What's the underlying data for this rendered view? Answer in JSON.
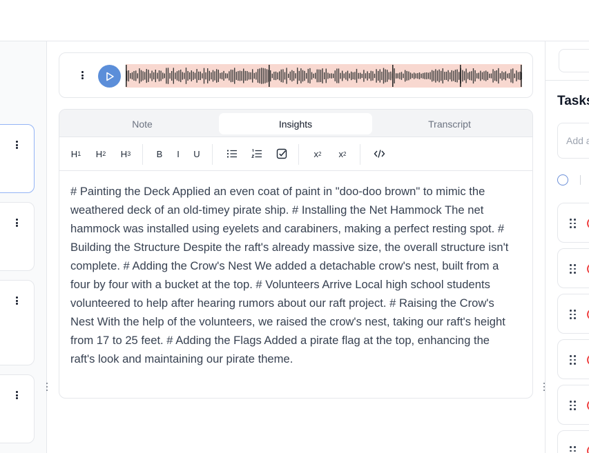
{
  "audio": {
    "menu_icon": "vertical-ellipsis-icon",
    "play_icon": "play-icon",
    "accent_color": "#5b8ed9",
    "waveform_bg": "#f8d8d0"
  },
  "tabs": [
    {
      "label": "Note",
      "active": false
    },
    {
      "label": "Insights",
      "active": true
    },
    {
      "label": "Transcript",
      "active": false
    }
  ],
  "toolbar": {
    "h1": {
      "main": "H",
      "sub": "1"
    },
    "h2": {
      "main": "H",
      "sub": "2"
    },
    "h3": {
      "main": "H",
      "sub": "3"
    },
    "bold": "B",
    "italic": "I",
    "underline": "U",
    "subscript": {
      "main": "x",
      "sub": "2"
    },
    "superscript": {
      "main": "x",
      "sup": "2"
    },
    "icons": [
      "bullet-list-icon",
      "numbered-list-icon",
      "checklist-icon",
      "code-icon"
    ]
  },
  "editor": {
    "content": "# Painting the Deck Applied an even coat of paint in \"doo-doo brown\" to mimic the weathered deck of an old-timey pirate ship. # Installing the Net Hammock The net hammock was installed using eyelets and carabiners, making a perfect resting spot. # Building the Structure Despite the raft's already massive size, the overall structure isn't complete. # Adding the Crow's Nest We added a detachable crow's nest, built from a four by four with a bucket at the top. # Volunteers Arrive Local high school students volunteered to help after hearing rumors about our raft project. # Raising the Crow's Nest With the help of the volunteers, we raised the crow's nest, taking our raft's height from 17 to 25 feet. # Adding the Flags Added a pirate flag at the top, enhancing the raft's look and maintaining our pirate theme."
  },
  "tasks": {
    "title": "Tasks",
    "add_placeholder": "Add a",
    "status_color": "#ef4444"
  }
}
